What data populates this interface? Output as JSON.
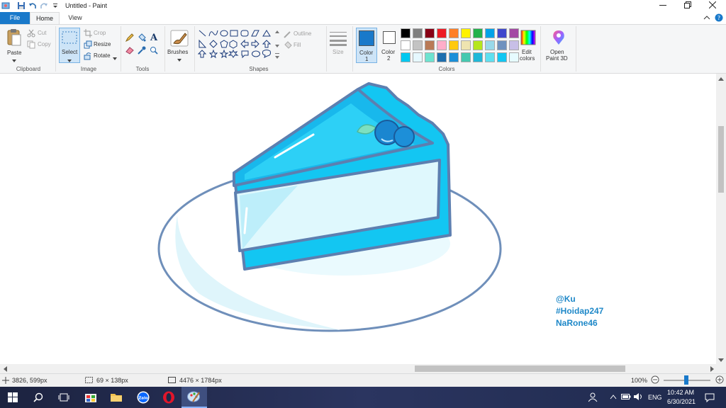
{
  "window": {
    "title": "Untitled - Paint",
    "minimize_icon": "minimize-icon",
    "maximize_icon": "restore-icon",
    "close_icon": "close-icon"
  },
  "tabs": {
    "file": "File",
    "home": "Home",
    "view": "View"
  },
  "clipboard": {
    "paste": "Paste",
    "cut": "Cut",
    "copy": "Copy",
    "label": "Clipboard"
  },
  "image": {
    "select": "Select",
    "crop": "Crop",
    "resize": "Resize",
    "rotate": "Rotate",
    "label": "Image"
  },
  "tools": {
    "label": "Tools"
  },
  "brushes": {
    "label": "Brushes"
  },
  "shapes": {
    "outline": "Outline",
    "fill": "Fill",
    "label": "Shapes"
  },
  "size": {
    "label": "Size"
  },
  "color1": {
    "label": "Color",
    "num": "1",
    "value": "#1979ca"
  },
  "color2": {
    "label": "Color",
    "num": "2",
    "value": "#ffffff"
  },
  "colors": {
    "label": "Colors",
    "row1": [
      "#000000",
      "#7f7f7f",
      "#880015",
      "#ed1c24",
      "#ff7f27",
      "#fff200",
      "#22b14c",
      "#00a2e8",
      "#3f48cc",
      "#a349a4"
    ],
    "row2": [
      "#ffffff",
      "#c3c3c3",
      "#b97a57",
      "#ffaec9",
      "#ffc90e",
      "#efe4b0",
      "#b5e61d",
      "#99d9ea",
      "#7092be",
      "#c8bfe7"
    ],
    "row3": [
      "#00c8f0",
      "#e6f8ff",
      "#6de3d0",
      "#1d6fae",
      "#1a8fd8",
      "#45c8b0",
      "#1fb8d8",
      "#5fe0f0",
      "#13c6f2",
      "#e6fbff"
    ]
  },
  "edit_colors": {
    "line1": "Edit",
    "line2": "colors"
  },
  "paint3d": {
    "line1": "Open",
    "line2": "Paint 3D"
  },
  "canvas": {
    "watermark": [
      "@Ku",
      "#Hoidap247",
      "NaRone46"
    ]
  },
  "status": {
    "cursor_pos": "3826, 599px",
    "selection_size": "69 × 138px",
    "image_size": "4476 × 1784px",
    "zoom": "100%"
  },
  "taskbar": {
    "lang": "ENG",
    "time": "10:42 AM",
    "date": "6/30/2021"
  }
}
